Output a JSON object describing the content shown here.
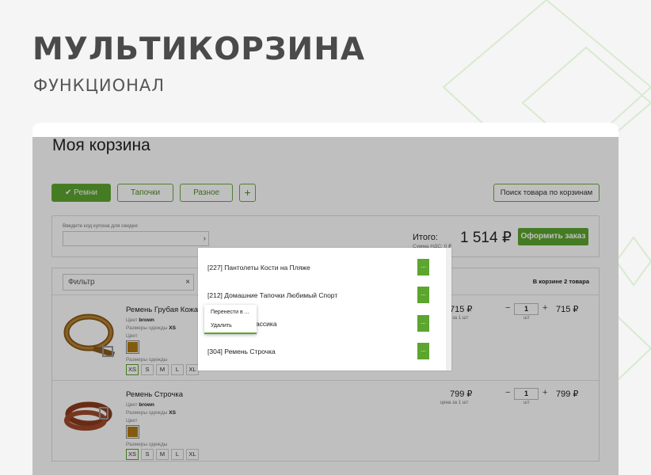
{
  "promo": {
    "title": "МУЛЬТИКОРЗИНА",
    "subtitle": "ФУНКЦИОНАЛ"
  },
  "cart": {
    "title": "Моя корзина",
    "tabs": [
      {
        "label": "✔ Ремни",
        "active": true
      },
      {
        "label": "Тапочки",
        "active": false
      },
      {
        "label": "Разное",
        "active": false
      }
    ],
    "add_tab_label": "+",
    "search_carts_label": "Поиск товара по корзинам"
  },
  "summary": {
    "coupon_label": "Введите код купона для скидки:",
    "coupon_button_label": "›",
    "total_label": "Итого:",
    "vat_label": "Сумма НДС: 0 ₽",
    "total_value": "1 514 ₽",
    "order_button_label": "Оформить заказ"
  },
  "list": {
    "filter_placeholder": "Фильтр",
    "filter_clear": "×",
    "count_label": "В корзине 2 товара",
    "items": [
      {
        "name": "Ремень Грубая Кожа",
        "color_label": "Цвет",
        "color_value": "brown",
        "clothes_size_label": "Размеры одежды",
        "clothes_size_value": "XS",
        "swatch_label": "Цвет",
        "sizes_label": "Размеры одежды",
        "sizes": [
          "XS",
          "S",
          "M",
          "L",
          "XL"
        ],
        "selected_size": "XS",
        "price": "715 ₽",
        "price_sub": "цена за 1 шт",
        "minus": "−",
        "qty": "1",
        "plus": "+",
        "unit": "шт",
        "line_total": "715 ₽"
      },
      {
        "name": "Ремень Строчка",
        "color_label": "Цвет",
        "color_value": "brown",
        "clothes_size_label": "Размеры одежды",
        "clothes_size_value": "XS",
        "swatch_label": "Цвет",
        "sizes_label": "Размеры одежды",
        "sizes": [
          "XS",
          "S",
          "M",
          "L",
          "XL"
        ],
        "selected_size": "XS",
        "price": "799 ₽",
        "price_sub": "цена за 1 шт",
        "minus": "−",
        "qty": "1",
        "plus": "+",
        "unit": "шт",
        "line_total": "799 ₽"
      }
    ]
  },
  "popup": {
    "rows": [
      {
        "text": "[227] Пантолеты Кости на Пляже",
        "button": "..."
      },
      {
        "text": "[212] Домашние Тапочки Любимый Спорт",
        "button": "..."
      },
      {
        "text": "лассика",
        "button": "..."
      },
      {
        "text": "[304] Ремень Строчка",
        "button": "..."
      }
    ]
  },
  "context_menu": {
    "move_label": "Перенести в ...",
    "delete_label": "Удалить"
  },
  "colors": {
    "accent": "#5ca52f",
    "swatch": "#b07a10"
  }
}
